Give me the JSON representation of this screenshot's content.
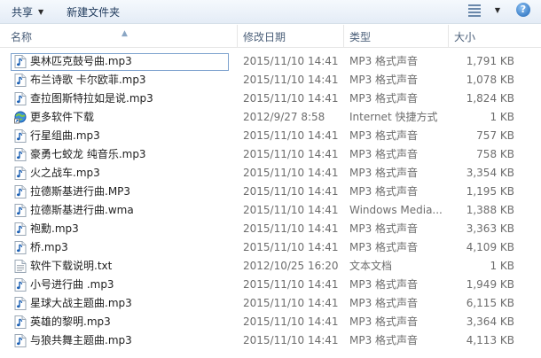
{
  "toolbar": {
    "share_label": "共享",
    "new_folder_label": "新建文件夹",
    "view_icon": "view-options-icon",
    "help_icon": "help-icon",
    "help_glyph": "?"
  },
  "columns": {
    "name": "名称",
    "date": "修改日期",
    "type": "类型",
    "size": "大小"
  },
  "files": [
    {
      "name": "奥林匹克鼓号曲.mp3",
      "date": "2015/11/10 14:41",
      "type": "MP3 格式声音",
      "size": "1,791 KB",
      "icon": "mp3",
      "selected": true
    },
    {
      "name": "布兰诗歌 卡尔欧菲.mp3",
      "date": "2015/11/10 14:41",
      "type": "MP3 格式声音",
      "size": "1,078 KB",
      "icon": "mp3"
    },
    {
      "name": "查拉图斯特拉如是说.mp3",
      "date": "2015/11/10 14:41",
      "type": "MP3 格式声音",
      "size": "1,824 KB",
      "icon": "mp3"
    },
    {
      "name": "更多软件下载",
      "date": "2012/9/27 8:58",
      "type": "Internet 快捷方式",
      "size": "1 KB",
      "icon": "url"
    },
    {
      "name": "行星组曲.mp3",
      "date": "2015/11/10 14:41",
      "type": "MP3 格式声音",
      "size": "757 KB",
      "icon": "mp3"
    },
    {
      "name": "豪勇七蛟龙 纯音乐.mp3",
      "date": "2015/11/10 14:41",
      "type": "MP3 格式声音",
      "size": "758 KB",
      "icon": "mp3"
    },
    {
      "name": "火之战车.mp3",
      "date": "2015/11/10 14:41",
      "type": "MP3 格式声音",
      "size": "3,354 KB",
      "icon": "mp3"
    },
    {
      "name": "拉德斯基进行曲.MP3",
      "date": "2015/11/10 14:41",
      "type": "MP3 格式声音",
      "size": "1,195 KB",
      "icon": "mp3"
    },
    {
      "name": "拉德斯基进行曲.wma",
      "date": "2015/11/10 14:41",
      "type": "Windows Media...",
      "size": "1,388 KB",
      "icon": "wma"
    },
    {
      "name": "袍勳.mp3",
      "date": "2015/11/10 14:41",
      "type": "MP3 格式声音",
      "size": "3,363 KB",
      "icon": "mp3"
    },
    {
      "name": "桥.mp3",
      "date": "2015/11/10 14:41",
      "type": "MP3 格式声音",
      "size": "4,109 KB",
      "icon": "mp3"
    },
    {
      "name": "软件下载说明.txt",
      "date": "2012/10/25 16:20",
      "type": "文本文档",
      "size": "1 KB",
      "icon": "txt"
    },
    {
      "name": "小号进行曲 .mp3",
      "date": "2015/11/10 14:41",
      "type": "MP3 格式声音",
      "size": "1,949 KB",
      "icon": "mp3"
    },
    {
      "name": "星球大战主题曲.mp3",
      "date": "2015/11/10 14:41",
      "type": "MP3 格式声音",
      "size": "6,115 KB",
      "icon": "mp3"
    },
    {
      "name": "英雄的黎明.mp3",
      "date": "2015/11/10 14:41",
      "type": "MP3 格式声音",
      "size": "3,364 KB",
      "icon": "mp3"
    },
    {
      "name": "与狼共舞主题曲.mp3",
      "date": "2015/11/10 14:41",
      "type": "MP3 格式声音",
      "size": "4,113 KB",
      "icon": "mp3"
    }
  ],
  "colors": {
    "selection_border": "#7da2ce",
    "header_text": "#4c607a",
    "secondary_text": "#6d6d6d"
  }
}
